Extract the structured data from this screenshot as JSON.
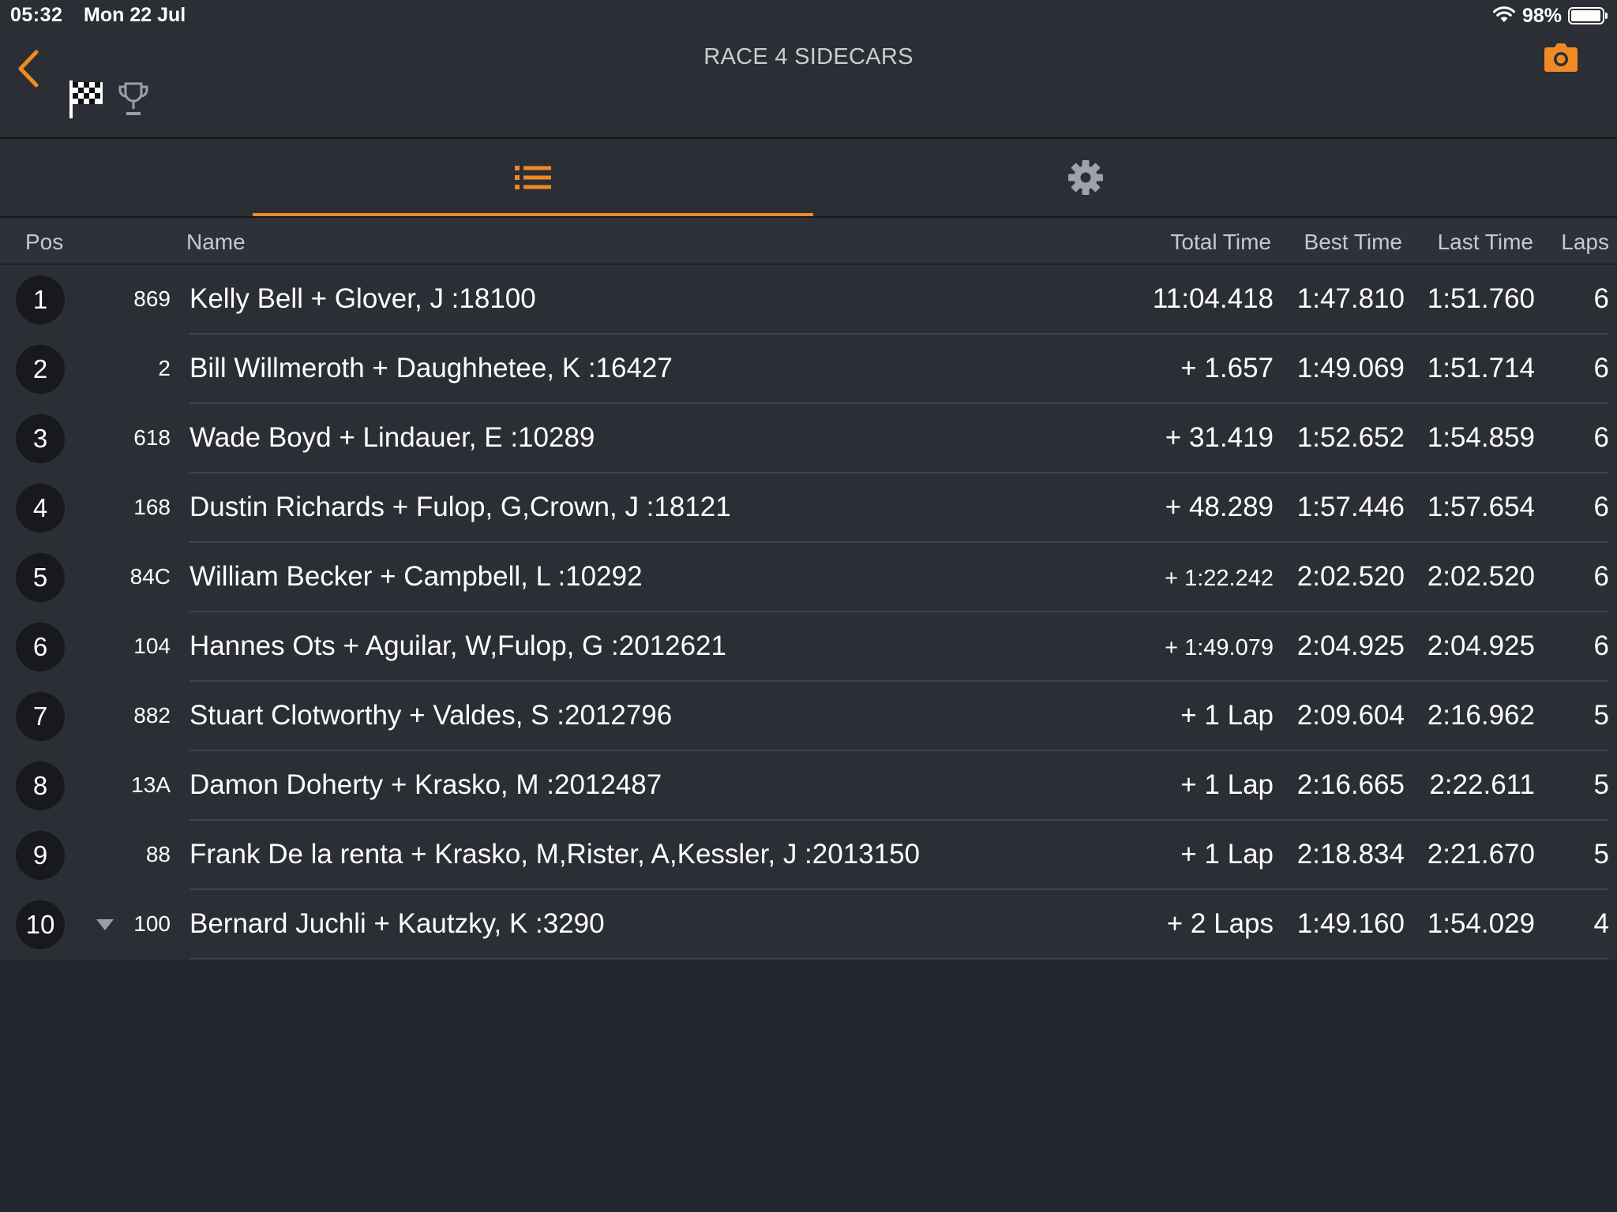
{
  "status_bar": {
    "time": "05:32",
    "date": "Mon 22 Jul",
    "battery_pct": "98%",
    "battery_level": 0.98
  },
  "nav": {
    "title": "RACE 4 SIDECARS",
    "back_icon": "chevron-left-icon",
    "flag_icon": "checkered-flag-icon",
    "trophy_icon": "trophy-icon",
    "camera_icon": "camera-icon"
  },
  "tabs": {
    "list_icon": "list-icon",
    "settings_icon": "gear-icon"
  },
  "accent": "#f08a24",
  "columns": {
    "pos": "Pos",
    "name": "Name",
    "total": "Total Time",
    "best": "Best Time",
    "last": "Last Time",
    "laps": "Laps"
  },
  "rows": [
    {
      "pos": "1",
      "num": "869",
      "name": "Kelly Bell + Glover, J :18100",
      "total": "11:04.418",
      "best": "1:47.810",
      "last": "1:51.760",
      "laps": "6"
    },
    {
      "pos": "2",
      "num": "2",
      "name": "Bill Willmeroth + Daughhetee, K :16427",
      "total": "+ 1.657",
      "best": "1:49.069",
      "last": "1:51.714",
      "laps": "6"
    },
    {
      "pos": "3",
      "num": "618",
      "name": "Wade Boyd + Lindauer, E :10289",
      "total": "+ 31.419",
      "best": "1:52.652",
      "last": "1:54.859",
      "laps": "6"
    },
    {
      "pos": "4",
      "num": "168",
      "name": "Dustin Richards + Fulop, G,Crown, J :18121",
      "total": "+ 48.289",
      "best": "1:57.446",
      "last": "1:57.654",
      "laps": "6"
    },
    {
      "pos": "5",
      "num": "84C",
      "name": "William Becker + Campbell, L :10292",
      "total": "+ 1:22.242",
      "best": "2:02.520",
      "last": "2:02.520",
      "laps": "6"
    },
    {
      "pos": "6",
      "num": "104",
      "name": "Hannes Ots + Aguilar, W,Fulop, G :2012621",
      "total": "+ 1:49.079",
      "best": "2:04.925",
      "last": "2:04.925",
      "laps": "6"
    },
    {
      "pos": "7",
      "num": "882",
      "name": "Stuart Clotworthy + Valdes, S :2012796",
      "total": "+ 1 Lap",
      "best": "2:09.604",
      "last": "2:16.962",
      "laps": "5"
    },
    {
      "pos": "8",
      "num": "13A",
      "name": "Damon Doherty + Krasko, M :2012487",
      "total": "+ 1 Lap",
      "best": "2:16.665",
      "last": "2:22.611",
      "laps": "5"
    },
    {
      "pos": "9",
      "num": "88",
      "name": "Frank De la renta + Krasko, M,Rister, A,Kessler, J :2013150",
      "total": "+ 1 Lap",
      "best": "2:18.834",
      "last": "2:21.670",
      "laps": "5"
    },
    {
      "pos": "10",
      "num": "100",
      "name": "Bernard Juchli + Kautzky, K :3290",
      "total": "+ 2 Laps",
      "best": "1:49.160",
      "last": "1:54.029",
      "laps": "4",
      "trend_icon": "triangle-down-icon"
    }
  ]
}
